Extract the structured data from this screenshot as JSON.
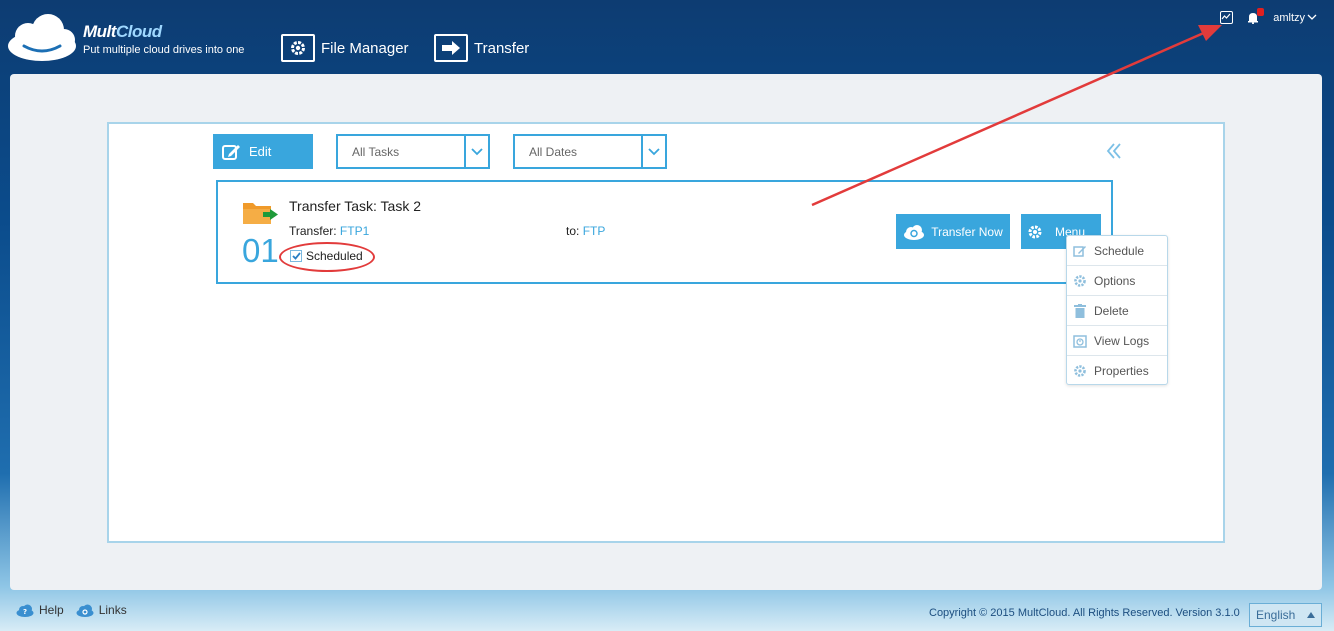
{
  "header": {
    "brand_prefix": "Mult",
    "brand_suffix": "Cloud",
    "tagline": "Put multiple cloud drives into one",
    "nav": [
      {
        "label": "File Manager",
        "icon": "gear-icon"
      },
      {
        "label": "Transfer",
        "icon": "arrow-right-icon"
      }
    ],
    "username": "amltzy"
  },
  "toolbar": {
    "edit_label": "Edit",
    "tasks_filter": "All Tasks",
    "dates_filter": "All Dates"
  },
  "task": {
    "number": "01",
    "title": "Transfer Task: Task 2",
    "from_label": "Transfer:",
    "from_value": "FTP1",
    "to_label": "to:",
    "to_value": "FTP",
    "scheduled_label": "Scheduled",
    "transfer_now_label": "Transfer Now",
    "menu_label": "Menu"
  },
  "menu": {
    "items": [
      {
        "label": "Schedule",
        "icon": "edit-icon"
      },
      {
        "label": "Options",
        "icon": "gear-icon"
      },
      {
        "label": "Delete",
        "icon": "trash-icon"
      },
      {
        "label": "View Logs",
        "icon": "clock-icon"
      },
      {
        "label": "Properties",
        "icon": "gear-icon"
      }
    ]
  },
  "footer": {
    "help_label": "Help",
    "links_label": "Links",
    "copyright": "Copyright © 2015 MultCloud. All Rights Reserved. Version 3.1.0",
    "language": "English"
  },
  "colors": {
    "accent": "#39a6dd",
    "annotation": "#e23b3b",
    "header_bg": "#0d3c72"
  }
}
